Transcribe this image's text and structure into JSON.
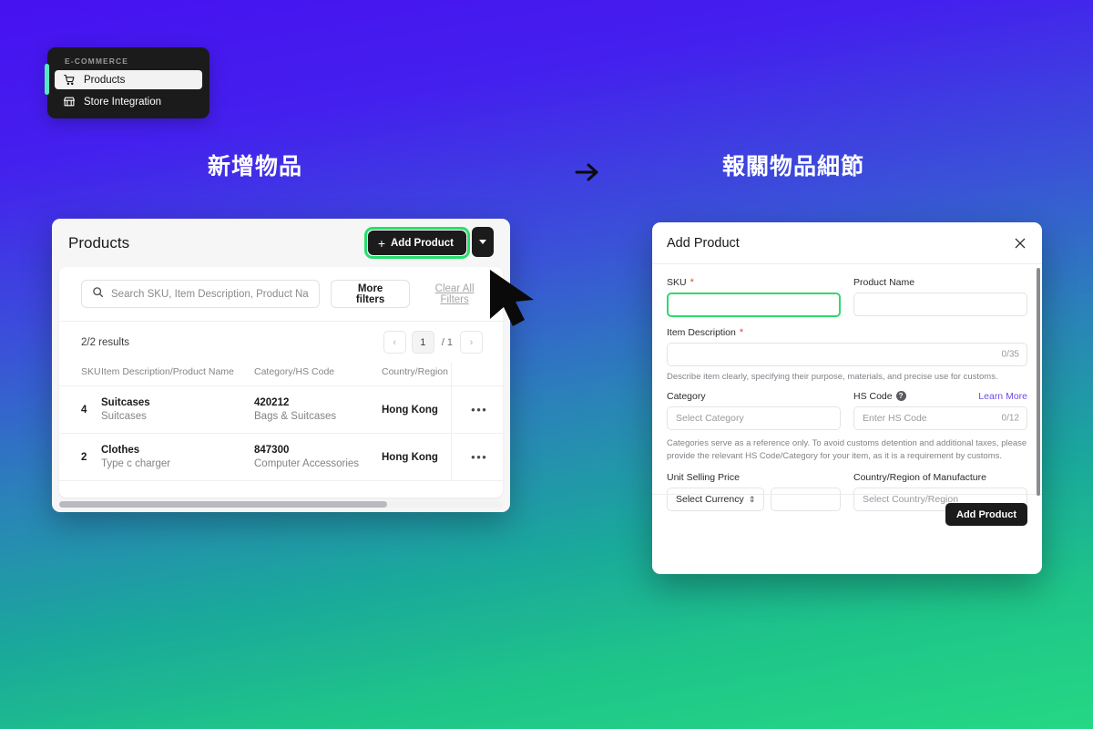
{
  "sidebar": {
    "section_label": "E-COMMERCE",
    "accent_color": "#58e8c0",
    "items": [
      {
        "label": "Products",
        "icon": "shopping-cart-icon",
        "active": true
      },
      {
        "label": "Store Integration",
        "icon": "storefront-icon",
        "active": false
      }
    ]
  },
  "annotations": {
    "left_title": "新增物品",
    "right_title": "報關物品細節",
    "arrow": "→"
  },
  "products_panel": {
    "title": "Products",
    "add_product_label": "Add Product",
    "add_product_plus": "+",
    "highlight_color": "#25e06c",
    "dropdown_caret": "caret-down-icon",
    "search": {
      "placeholder": "Search SKU, Item Description, Product Na",
      "value": "",
      "icon": "search-icon"
    },
    "more_filters_label": "More filters",
    "clear_filters_label": "Clear All Filters",
    "results_text": "2/2 results",
    "pagination": {
      "prev": "‹",
      "current_page": "1",
      "total_pages": "/ 1",
      "next": "›"
    },
    "table": {
      "columns": [
        "SKU",
        "Item Description/Product Name",
        "Category/HS Code",
        "Country/Region",
        "",
        ""
      ],
      "rows": [
        {
          "sku": "4",
          "description": "Suitcases",
          "product_name": "Suitcases",
          "hs_code": "420212",
          "category": "Bags & Suitcases",
          "country": "Hong Kong",
          "actions": "•••"
        },
        {
          "sku": "2",
          "description": "Clothes",
          "product_name": "Type c charger",
          "hs_code": "847300",
          "category": "Computer Accessories",
          "country": "Hong Kong",
          "actions": "•••"
        }
      ]
    }
  },
  "modal": {
    "title": "Add Product",
    "close_icon": "close-icon",
    "fields": {
      "sku": {
        "label": "SKU",
        "required": "*",
        "value": "",
        "placeholder": ""
      },
      "product_name": {
        "label": "Product Name",
        "value": "",
        "placeholder": ""
      },
      "item_description": {
        "label": "Item Description",
        "required": "*",
        "value": "",
        "placeholder": "",
        "counter": "0/35",
        "hint": "Describe item clearly, specifying their purpose, materials, and precise use for customs."
      },
      "category": {
        "label": "Category",
        "placeholder": "Select Category",
        "value": ""
      },
      "hs_code": {
        "label": "HS Code",
        "help_icon": "question-mark-icon",
        "learn_more": "Learn More",
        "placeholder": "Enter HS Code",
        "value": "",
        "counter": "0/12"
      },
      "category_hint": "Categories serve as a reference only. To avoid customs detention and additional taxes, please provide the relevant HS Code/Category for your item, as it is a requirement by customs.",
      "unit_selling_price": {
        "label": "Unit Selling Price",
        "currency_placeholder": "Select Currency",
        "value": "",
        "placeholder": ""
      },
      "country_of_manufacture": {
        "label": "Country/Region of Manufacture",
        "placeholder": "Select Country/Region",
        "value": ""
      }
    },
    "submit_label": "Add Product",
    "accent_color": "#6e4de8",
    "focus_color": "#2fd96b"
  }
}
